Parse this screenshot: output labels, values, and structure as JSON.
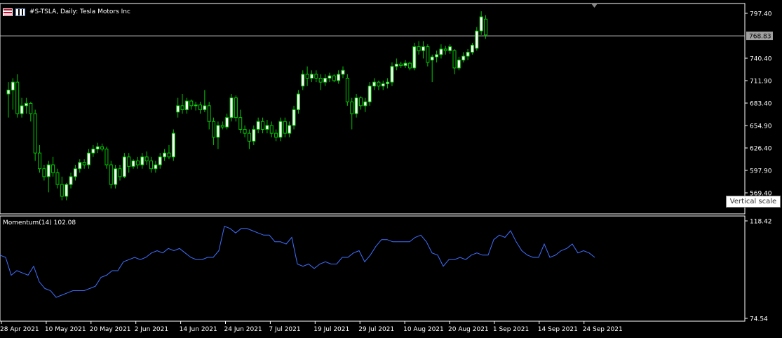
{
  "header": {
    "title": "#S-TSLA, Daily:  Tesla Motors Inc",
    "icons": [
      "instrument-flag-icon",
      "chart-type-icon"
    ]
  },
  "indicator": {
    "label": "Momentum(14) 102.08",
    "color": "#3f6fff"
  },
  "tooltip": {
    "text": "Vertical scale"
  },
  "price_axis": {
    "ticks": [
      "797.40",
      "768.83",
      "740.40",
      "711.90",
      "683.40",
      "654.90",
      "626.40",
      "597.90",
      "569.40"
    ],
    "current_price": "768.83"
  },
  "momentum_axis": {
    "ticks": [
      "118.42",
      "74.54"
    ]
  },
  "time_axis": {
    "labels": [
      "28 Apr 2021",
      "10 May 2021",
      "20 May 2021",
      "2 Jun 2021",
      "14 Jun 2021",
      "24 Jun 2021",
      "7 Jul 2021",
      "19 Jul 2021",
      "29 Jul 2021",
      "10 Aug 2021",
      "20 Aug 2021",
      "1 Sep 2021",
      "14 Sep 2021",
      "24 Sep 2021"
    ]
  },
  "colors": {
    "background": "#000000",
    "bull_candle": "#ffffff",
    "bear_candle": "#000000",
    "candle_outline": "#00c800",
    "axis_text": "#ffffff",
    "current_price_line": "#c0c0c0",
    "current_price_tag": "#a0a0a0"
  },
  "chart_data": [
    {
      "type": "candlestick",
      "title": "#S-TSLA, Daily:  Tesla Motors Inc",
      "ylim": [
        569.4,
        797.4
      ],
      "current_price": 768.83,
      "candles": [
        {
          "o": 695,
          "h": 710,
          "l": 665,
          "c": 700
        },
        {
          "o": 700,
          "h": 715,
          "l": 675,
          "c": 710
        },
        {
          "o": 710,
          "h": 720,
          "l": 665,
          "c": 670
        },
        {
          "o": 670,
          "h": 690,
          "l": 665,
          "c": 680
        },
        {
          "o": 680,
          "h": 690,
          "l": 670,
          "c": 683
        },
        {
          "o": 683,
          "h": 685,
          "l": 660,
          "c": 670
        },
        {
          "o": 670,
          "h": 675,
          "l": 610,
          "c": 620
        },
        {
          "o": 620,
          "h": 630,
          "l": 595,
          "c": 600
        },
        {
          "o": 600,
          "h": 605,
          "l": 585,
          "c": 590
        },
        {
          "o": 590,
          "h": 610,
          "l": 570,
          "c": 605
        },
        {
          "o": 605,
          "h": 615,
          "l": 590,
          "c": 595
        },
        {
          "o": 595,
          "h": 600,
          "l": 575,
          "c": 580
        },
        {
          "o": 580,
          "h": 590,
          "l": 560,
          "c": 565
        },
        {
          "o": 565,
          "h": 582,
          "l": 560,
          "c": 580
        },
        {
          "o": 580,
          "h": 595,
          "l": 575,
          "c": 590
        },
        {
          "o": 590,
          "h": 605,
          "l": 585,
          "c": 600
        },
        {
          "o": 600,
          "h": 612,
          "l": 595,
          "c": 608
        },
        {
          "o": 608,
          "h": 612,
          "l": 600,
          "c": 605
        },
        {
          "o": 605,
          "h": 625,
          "l": 600,
          "c": 620
        },
        {
          "o": 620,
          "h": 630,
          "l": 615,
          "c": 625
        },
        {
          "o": 625,
          "h": 633,
          "l": 620,
          "c": 628
        },
        {
          "o": 628,
          "h": 632,
          "l": 622,
          "c": 625
        },
        {
          "o": 625,
          "h": 628,
          "l": 600,
          "c": 605
        },
        {
          "o": 605,
          "h": 610,
          "l": 575,
          "c": 580
        },
        {
          "o": 580,
          "h": 605,
          "l": 575,
          "c": 600
        },
        {
          "o": 600,
          "h": 605,
          "l": 585,
          "c": 590
        },
        {
          "o": 590,
          "h": 620,
          "l": 588,
          "c": 615
        },
        {
          "o": 615,
          "h": 620,
          "l": 595,
          "c": 603
        },
        {
          "o": 603,
          "h": 612,
          "l": 600,
          "c": 610
        },
        {
          "o": 610,
          "h": 615,
          "l": 600,
          "c": 605
        },
        {
          "o": 605,
          "h": 620,
          "l": 600,
          "c": 615
        },
        {
          "o": 615,
          "h": 622,
          "l": 605,
          "c": 610
        },
        {
          "o": 610,
          "h": 615,
          "l": 595,
          "c": 600
        },
        {
          "o": 600,
          "h": 610,
          "l": 595,
          "c": 605
        },
        {
          "o": 605,
          "h": 620,
          "l": 600,
          "c": 615
        },
        {
          "o": 615,
          "h": 625,
          "l": 610,
          "c": 620
        },
        {
          "o": 620,
          "h": 630,
          "l": 612,
          "c": 615
        },
        {
          "o": 615,
          "h": 650,
          "l": 610,
          "c": 645
        },
        {
          "o": 672,
          "h": 690,
          "l": 665,
          "c": 680
        },
        {
          "o": 680,
          "h": 695,
          "l": 670,
          "c": 675
        },
        {
          "o": 675,
          "h": 690,
          "l": 670,
          "c": 686
        },
        {
          "o": 686,
          "h": 688,
          "l": 675,
          "c": 680
        },
        {
          "o": 680,
          "h": 685,
          "l": 674,
          "c": 681
        },
        {
          "o": 681,
          "h": 685,
          "l": 670,
          "c": 675
        },
        {
          "o": 675,
          "h": 700,
          "l": 672,
          "c": 680
        },
        {
          "o": 680,
          "h": 685,
          "l": 650,
          "c": 660
        },
        {
          "o": 660,
          "h": 665,
          "l": 630,
          "c": 640
        },
        {
          "o": 640,
          "h": 660,
          "l": 625,
          "c": 655
        },
        {
          "o": 655,
          "h": 660,
          "l": 650,
          "c": 653
        },
        {
          "o": 653,
          "h": 670,
          "l": 650,
          "c": 665
        },
        {
          "o": 665,
          "h": 695,
          "l": 660,
          "c": 690
        },
        {
          "o": 690,
          "h": 693,
          "l": 660,
          "c": 665
        },
        {
          "o": 665,
          "h": 675,
          "l": 645,
          "c": 650
        },
        {
          "o": 650,
          "h": 655,
          "l": 640,
          "c": 645
        },
        {
          "o": 645,
          "h": 650,
          "l": 625,
          "c": 635
        },
        {
          "o": 635,
          "h": 655,
          "l": 630,
          "c": 650
        },
        {
          "o": 650,
          "h": 665,
          "l": 645,
          "c": 660
        },
        {
          "o": 660,
          "h": 665,
          "l": 645,
          "c": 650
        },
        {
          "o": 650,
          "h": 662,
          "l": 645,
          "c": 655
        },
        {
          "o": 655,
          "h": 660,
          "l": 640,
          "c": 645
        },
        {
          "o": 645,
          "h": 650,
          "l": 635,
          "c": 640
        },
        {
          "o": 640,
          "h": 665,
          "l": 635,
          "c": 660
        },
        {
          "o": 660,
          "h": 665,
          "l": 640,
          "c": 645
        },
        {
          "o": 645,
          "h": 660,
          "l": 640,
          "c": 655
        },
        {
          "o": 655,
          "h": 680,
          "l": 650,
          "c": 675
        },
        {
          "o": 675,
          "h": 700,
          "l": 670,
          "c": 695
        },
        {
          "o": 705,
          "h": 725,
          "l": 700,
          "c": 720
        },
        {
          "o": 720,
          "h": 730,
          "l": 705,
          "c": 715
        },
        {
          "o": 715,
          "h": 725,
          "l": 710,
          "c": 720
        },
        {
          "o": 720,
          "h": 725,
          "l": 710,
          "c": 715
        },
        {
          "o": 715,
          "h": 720,
          "l": 700,
          "c": 710
        },
        {
          "o": 710,
          "h": 720,
          "l": 705,
          "c": 715
        },
        {
          "o": 715,
          "h": 722,
          "l": 710,
          "c": 718
        },
        {
          "o": 718,
          "h": 720,
          "l": 710,
          "c": 712
        },
        {
          "o": 712,
          "h": 725,
          "l": 708,
          "c": 720
        },
        {
          "o": 720,
          "h": 730,
          "l": 715,
          "c": 725
        },
        {
          "o": 715,
          "h": 720,
          "l": 680,
          "c": 685
        },
        {
          "o": 685,
          "h": 690,
          "l": 650,
          "c": 670
        },
        {
          "o": 670,
          "h": 695,
          "l": 665,
          "c": 690
        },
        {
          "o": 690,
          "h": 692,
          "l": 675,
          "c": 680
        },
        {
          "o": 680,
          "h": 690,
          "l": 672,
          "c": 685
        },
        {
          "o": 685,
          "h": 710,
          "l": 680,
          "c": 705
        },
        {
          "o": 705,
          "h": 715,
          "l": 700,
          "c": 710
        },
        {
          "o": 710,
          "h": 712,
          "l": 700,
          "c": 705
        },
        {
          "o": 705,
          "h": 712,
          "l": 700,
          "c": 708
        },
        {
          "o": 708,
          "h": 715,
          "l": 702,
          "c": 710
        },
        {
          "o": 710,
          "h": 735,
          "l": 705,
          "c": 730
        },
        {
          "o": 730,
          "h": 740,
          "l": 725,
          "c": 733
        },
        {
          "o": 733,
          "h": 736,
          "l": 728,
          "c": 731
        },
        {
          "o": 731,
          "h": 738,
          "l": 728,
          "c": 734
        },
        {
          "o": 734,
          "h": 736,
          "l": 725,
          "c": 728
        },
        {
          "o": 728,
          "h": 760,
          "l": 725,
          "c": 755
        },
        {
          "o": 755,
          "h": 762,
          "l": 745,
          "c": 750
        },
        {
          "o": 750,
          "h": 762,
          "l": 740,
          "c": 755
        },
        {
          "o": 755,
          "h": 758,
          "l": 730,
          "c": 735
        },
        {
          "o": 738,
          "h": 745,
          "l": 710,
          "c": 742
        },
        {
          "o": 742,
          "h": 750,
          "l": 735,
          "c": 745
        },
        {
          "o": 745,
          "h": 758,
          "l": 740,
          "c": 752
        },
        {
          "o": 752,
          "h": 756,
          "l": 745,
          "c": 750
        },
        {
          "o": 750,
          "h": 758,
          "l": 746,
          "c": 755
        },
        {
          "o": 750,
          "h": 752,
          "l": 720,
          "c": 728
        },
        {
          "o": 728,
          "h": 742,
          "l": 725,
          "c": 738
        },
        {
          "o": 738,
          "h": 748,
          "l": 735,
          "c": 743
        },
        {
          "o": 743,
          "h": 752,
          "l": 738,
          "c": 748
        },
        {
          "o": 748,
          "h": 760,
          "l": 745,
          "c": 757
        },
        {
          "o": 753,
          "h": 780,
          "l": 750,
          "c": 775
        },
        {
          "o": 775,
          "h": 800,
          "l": 770,
          "c": 793
        },
        {
          "o": 790,
          "h": 795,
          "l": 765,
          "c": 770
        }
      ]
    },
    {
      "type": "line",
      "title": "Momentum(14) 102.08",
      "ylim": [
        74.54,
        118.42
      ],
      "series": [
        {
          "name": "Momentum(14)",
          "values": [
            103,
            102,
            94,
            96,
            95,
            94,
            98,
            91,
            88,
            87,
            84,
            85,
            86,
            87,
            87,
            87,
            88,
            89,
            93,
            94,
            96,
            96,
            100,
            101,
            102,
            101,
            102,
            104,
            105,
            104,
            106,
            105,
            106,
            104,
            102,
            101,
            101,
            102,
            102,
            105,
            116,
            115,
            113,
            115,
            115,
            114,
            113,
            112,
            112,
            109,
            109,
            108,
            111,
            99,
            98,
            99,
            97,
            99,
            100,
            99,
            99,
            102,
            102,
            104,
            105,
            100,
            103,
            107,
            110,
            110,
            109,
            109,
            109,
            109,
            111,
            112,
            109,
            104,
            103,
            98,
            101,
            101,
            102,
            101,
            103,
            104,
            103,
            103,
            110,
            112,
            111,
            114,
            109,
            105,
            103,
            102,
            102,
            108,
            102,
            103,
            105,
            106,
            108,
            104,
            105,
            104,
            102
          ]
        }
      ]
    }
  ]
}
